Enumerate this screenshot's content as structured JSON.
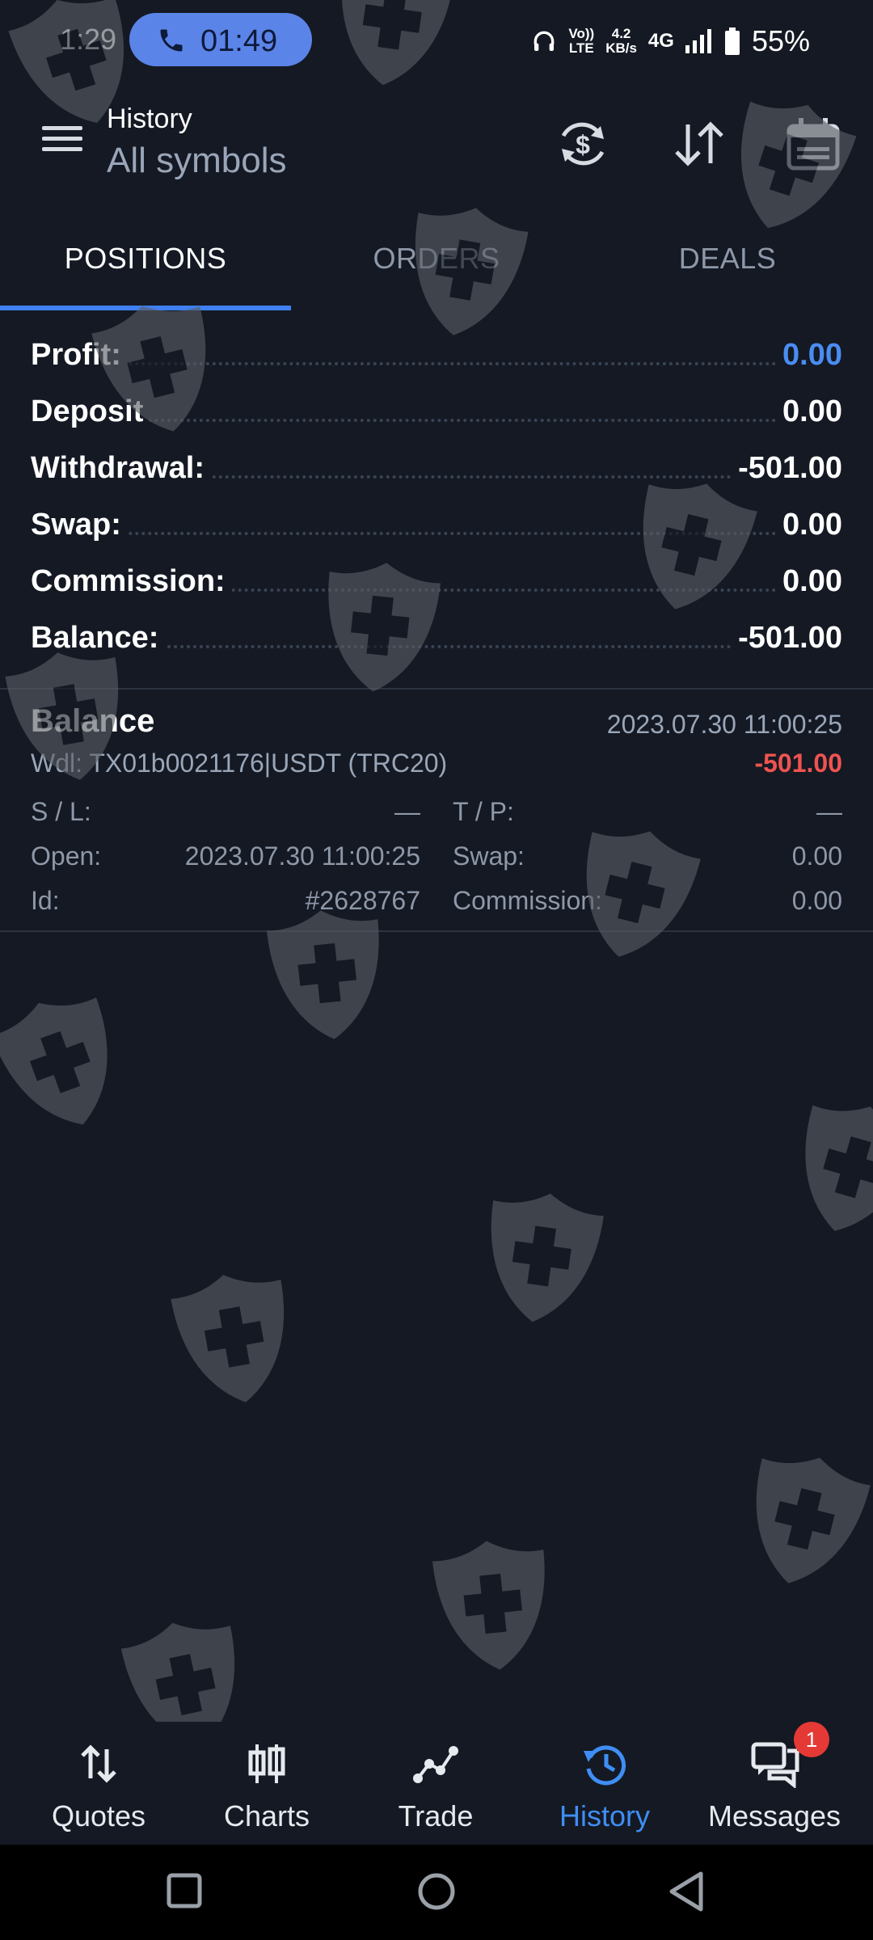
{
  "status_bar": {
    "time": "1:29",
    "call_timer": "01:49",
    "volte_top": "Vo))",
    "volte_bottom": "LTE",
    "speed_top": "4.2",
    "speed_bottom": "KB/s",
    "network": "4G",
    "battery": "55%"
  },
  "toolbar": {
    "title": "History",
    "subtitle": "All symbols",
    "icons": [
      "currency-refresh-icon",
      "sort-icon",
      "calendar-icon"
    ]
  },
  "tabs": [
    {
      "label": "POSITIONS",
      "active": true
    },
    {
      "label": "ORDERS",
      "active": false
    },
    {
      "label": "DEALS",
      "active": false
    }
  ],
  "summary": [
    {
      "label": "Profit:",
      "value": "0.00",
      "color": "#4a8df2"
    },
    {
      "label": "Deposit",
      "value": "0.00"
    },
    {
      "label": "Withdrawal:",
      "value": "-501.00"
    },
    {
      "label": "Swap:",
      "value": "0.00"
    },
    {
      "label": "Commission:",
      "value": "0.00"
    },
    {
      "label": "Balance:",
      "value": "-501.00"
    }
  ],
  "deal": {
    "type": "Balance",
    "date": "2023.07.30 11:00:25",
    "comment": "Wdl: TX01b0021176|USDT (TRC20)",
    "amount": "-501.00",
    "amount_color": "#ef5350",
    "sl_label": "S / L:",
    "sl_value": "—",
    "tp_label": "T / P:",
    "tp_value": "—",
    "open_label": "Open:",
    "open_value": "2023.07.30 11:00:25",
    "swap_label": "Swap:",
    "swap_value": "0.00",
    "id_label": "Id:",
    "id_value": "#2628767",
    "commission_label": "Commission:",
    "commission_value": "0.00"
  },
  "bottom_nav": [
    {
      "label": "Quotes",
      "icon": "quotes-icon",
      "active": false
    },
    {
      "label": "Charts",
      "icon": "charts-icon",
      "active": false
    },
    {
      "label": "Trade",
      "icon": "trade-icon",
      "active": false
    },
    {
      "label": "History",
      "icon": "history-icon",
      "active": true
    },
    {
      "label": "Messages",
      "icon": "messages-icon",
      "active": false,
      "badge": "1"
    }
  ],
  "colors": {
    "background": "#141923",
    "accent": "#3f7ff0",
    "loss": "#ef5350",
    "watermark": "#5a5e66"
  }
}
